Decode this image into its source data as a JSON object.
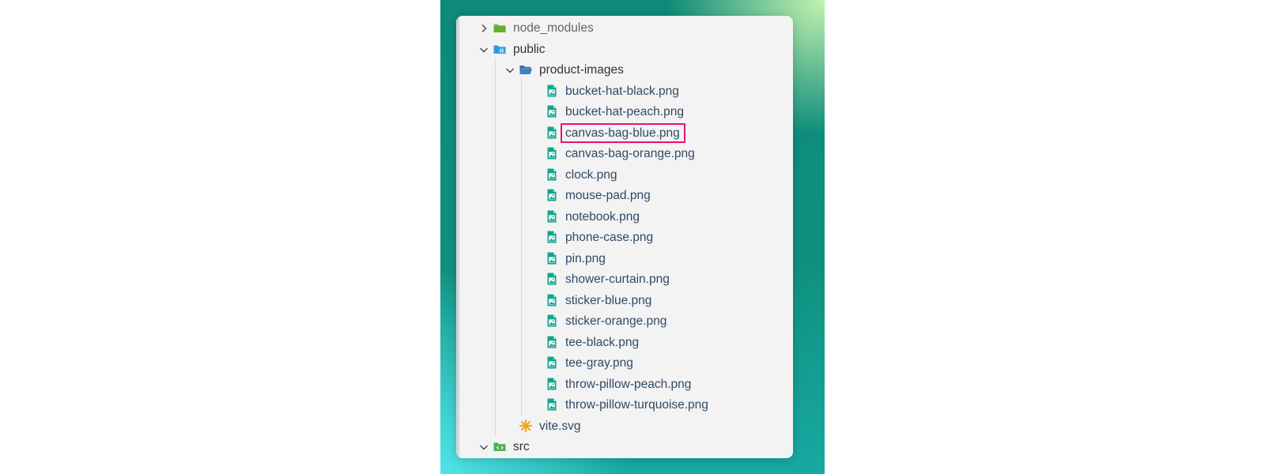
{
  "explorer": {
    "tree": [
      {
        "label": "node_modules",
        "kind": "folder",
        "state": "collapsed",
        "icon": "green-folder-icon",
        "depth": 0
      },
      {
        "label": "public",
        "kind": "folder",
        "state": "expanded",
        "icon": "public-folder-icon",
        "depth": 0
      },
      {
        "label": "product-images",
        "kind": "folder",
        "state": "expanded",
        "icon": "open-folder-icon",
        "depth": 1
      },
      {
        "label": "bucket-hat-black.png",
        "kind": "file",
        "icon": "image-file-icon",
        "depth": 2
      },
      {
        "label": "bucket-hat-peach.png",
        "kind": "file",
        "icon": "image-file-icon",
        "depth": 2
      },
      {
        "label": "canvas-bag-blue.png",
        "kind": "file",
        "icon": "image-file-icon",
        "depth": 2,
        "highlighted": true
      },
      {
        "label": "canvas-bag-orange.png",
        "kind": "file",
        "icon": "image-file-icon",
        "depth": 2
      },
      {
        "label": "clock.png",
        "kind": "file",
        "icon": "image-file-icon",
        "depth": 2
      },
      {
        "label": "mouse-pad.png",
        "kind": "file",
        "icon": "image-file-icon",
        "depth": 2
      },
      {
        "label": "notebook.png",
        "kind": "file",
        "icon": "image-file-icon",
        "depth": 2
      },
      {
        "label": "phone-case.png",
        "kind": "file",
        "icon": "image-file-icon",
        "depth": 2
      },
      {
        "label": "pin.png",
        "kind": "file",
        "icon": "image-file-icon",
        "depth": 2
      },
      {
        "label": "shower-curtain.png",
        "kind": "file",
        "icon": "image-file-icon",
        "depth": 2
      },
      {
        "label": "sticker-blue.png",
        "kind": "file",
        "icon": "image-file-icon",
        "depth": 2
      },
      {
        "label": "sticker-orange.png",
        "kind": "file",
        "icon": "image-file-icon",
        "depth": 2
      },
      {
        "label": "tee-black.png",
        "kind": "file",
        "icon": "image-file-icon",
        "depth": 2
      },
      {
        "label": "tee-gray.png",
        "kind": "file",
        "icon": "image-file-icon",
        "depth": 2
      },
      {
        "label": "throw-pillow-peach.png",
        "kind": "file",
        "icon": "image-file-icon",
        "depth": 2
      },
      {
        "label": "throw-pillow-turquoise.png",
        "kind": "file",
        "icon": "image-file-icon",
        "depth": 2
      },
      {
        "label": "vite.svg",
        "kind": "file",
        "icon": "vite-logo-icon",
        "depth": 1
      },
      {
        "label": "src",
        "kind": "folder",
        "state": "expanded",
        "icon": "src-folder-icon",
        "depth": 0
      }
    ]
  },
  "colors": {
    "panel_bg": "#f3f3f3",
    "highlight_border": "#e8136b",
    "image_icon": "#12a58b",
    "public_folder": "#2c9ae0",
    "node_modules_folder": "#7cc242",
    "product_folder": "#2f6fa8",
    "src_folder": "#4caf50",
    "vite_icon": "#f5a623"
  }
}
